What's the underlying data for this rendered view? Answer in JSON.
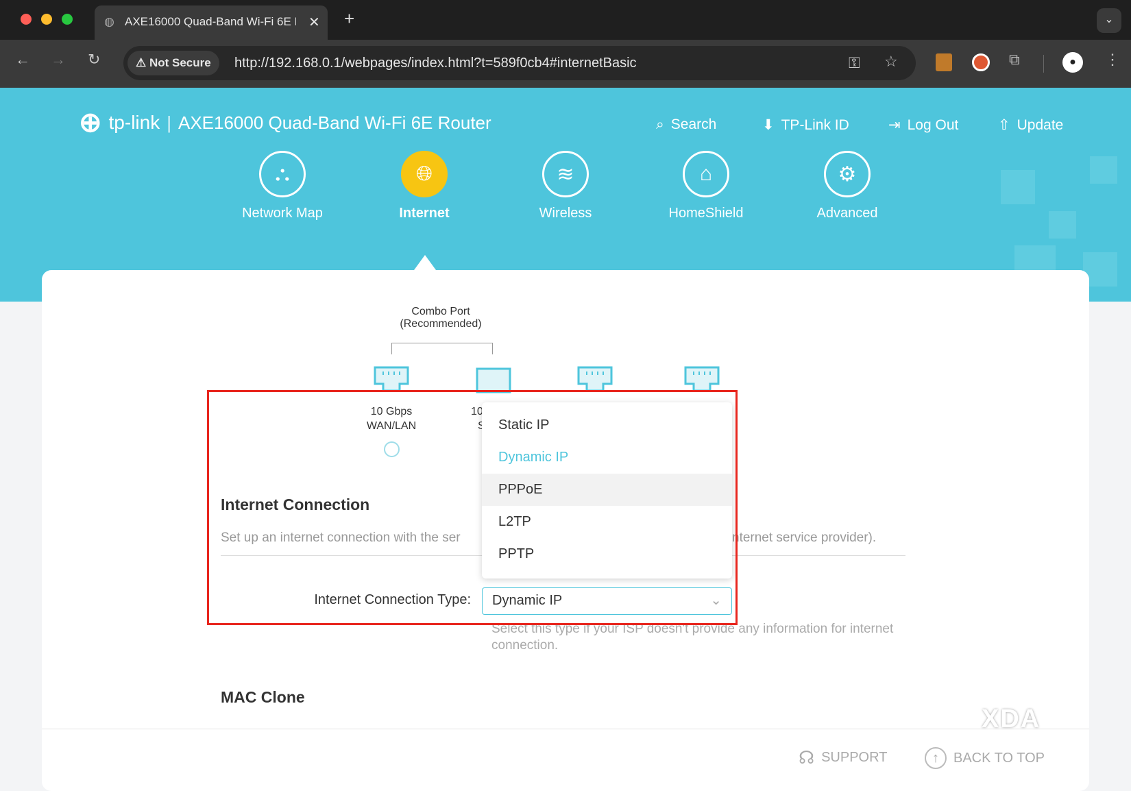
{
  "browser": {
    "tab_title": "AXE16000 Quad-Band Wi-Fi 6E Router",
    "security_label": "Not Secure",
    "url": "http://192.168.0.1/webpages/index.html?t=589f0cb4#internetBasic"
  },
  "header": {
    "brand": "tp-link",
    "product": "AXE16000 Quad-Band Wi-Fi 6E Router",
    "links": [
      "Search",
      "TP-Link ID",
      "Log Out",
      "Update"
    ]
  },
  "nav": [
    {
      "label": "Network Map",
      "icon": "network-map-icon"
    },
    {
      "label": "Internet",
      "icon": "globe-icon",
      "active": true
    },
    {
      "label": "Wireless",
      "icon": "wifi-icon"
    },
    {
      "label": "HomeShield",
      "icon": "shield-home-icon"
    },
    {
      "label": "Advanced",
      "icon": "gear-icon"
    }
  ],
  "ports": {
    "combo_label": "Combo Port",
    "combo_sub": "(Recommended)",
    "port1_speed": "10 Gbps",
    "port1_type": "WAN/LAN",
    "port2_speed_partial": "10",
    "port2_type_partial": "S"
  },
  "section": {
    "title": "Internet Connection",
    "desc_left": "Set up an internet connection with the ser",
    "desc_right": "nternet service provider).",
    "type_label": "Internet Connection Type:",
    "type_value": "Dynamic IP",
    "help": "Select this type if your ISP doesn't provide any information for internet connection."
  },
  "dropdown": {
    "options": [
      "Static IP",
      "Dynamic IP",
      "PPPoE",
      "L2TP",
      "PPTP"
    ],
    "selected": "Dynamic IP",
    "hovered": "PPPoE"
  },
  "mac": {
    "title": "MAC Clone"
  },
  "footer": {
    "support": "SUPPORT",
    "back_to_top": "BACK TO TOP"
  },
  "watermark": "XDA",
  "colors": {
    "accent": "#4ec5dc",
    "highlight": "#e8261e",
    "active_nav": "#f7c512"
  }
}
